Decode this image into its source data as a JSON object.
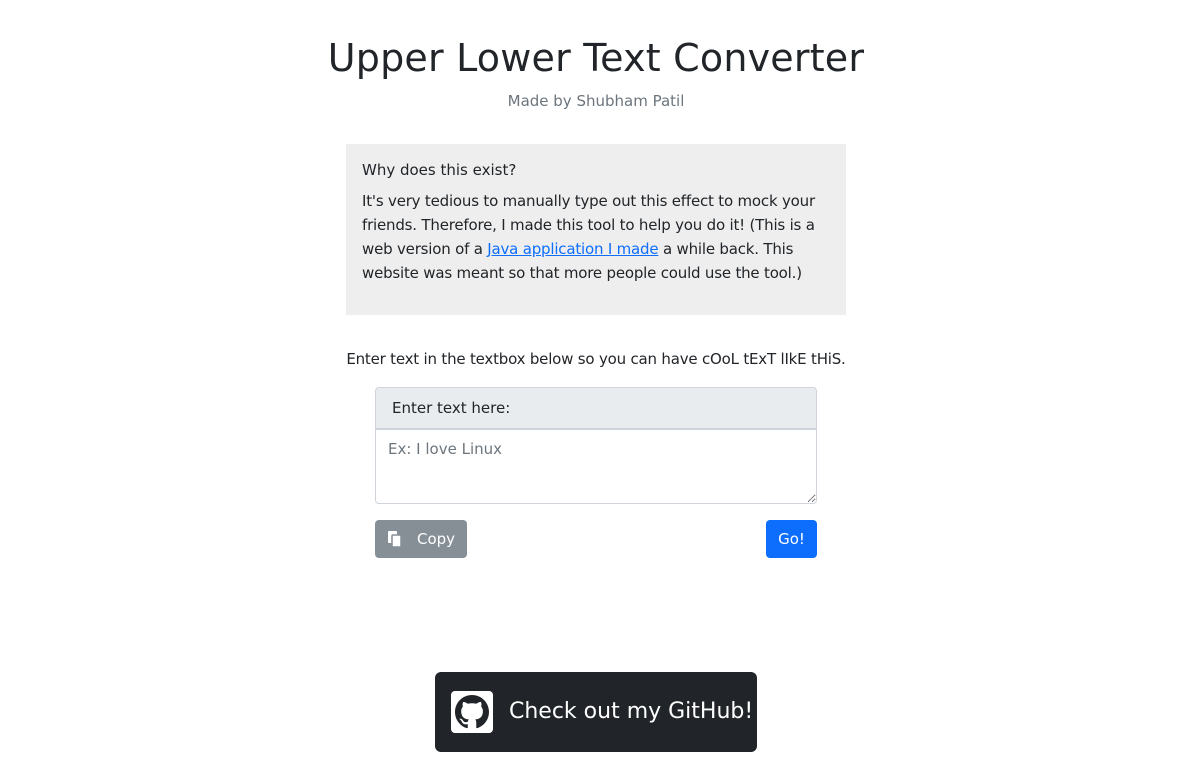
{
  "header": {
    "title": "Upper Lower Text Converter",
    "subtitle": "Made by Shubham Patil"
  },
  "info": {
    "heading": "Why does this exist?",
    "text_before_link": "It's very tedious to manually type out this effect to mock your friends. Therefore, I made this tool to help you do it! (This is a web version of a ",
    "link_text": "Java application I made",
    "text_after_link": " a while back. This website was meant so that more people could use the tool.)"
  },
  "instruction": "Enter text in the textbox below so you can have cOoL tExT lIkE tHiS.",
  "input": {
    "label": "Enter text here:",
    "placeholder": "Ex: I love Linux",
    "value": ""
  },
  "buttons": {
    "copy_label": "Copy",
    "copy_icon": "copy-icon",
    "go_label": "Go!"
  },
  "github": {
    "label": "Check out my GitHub!",
    "icon": "github-icon"
  },
  "colors": {
    "primary": "#0d6efd",
    "secondary": "#868e96",
    "dark": "#212529",
    "info_bg": "#eeeeee"
  }
}
